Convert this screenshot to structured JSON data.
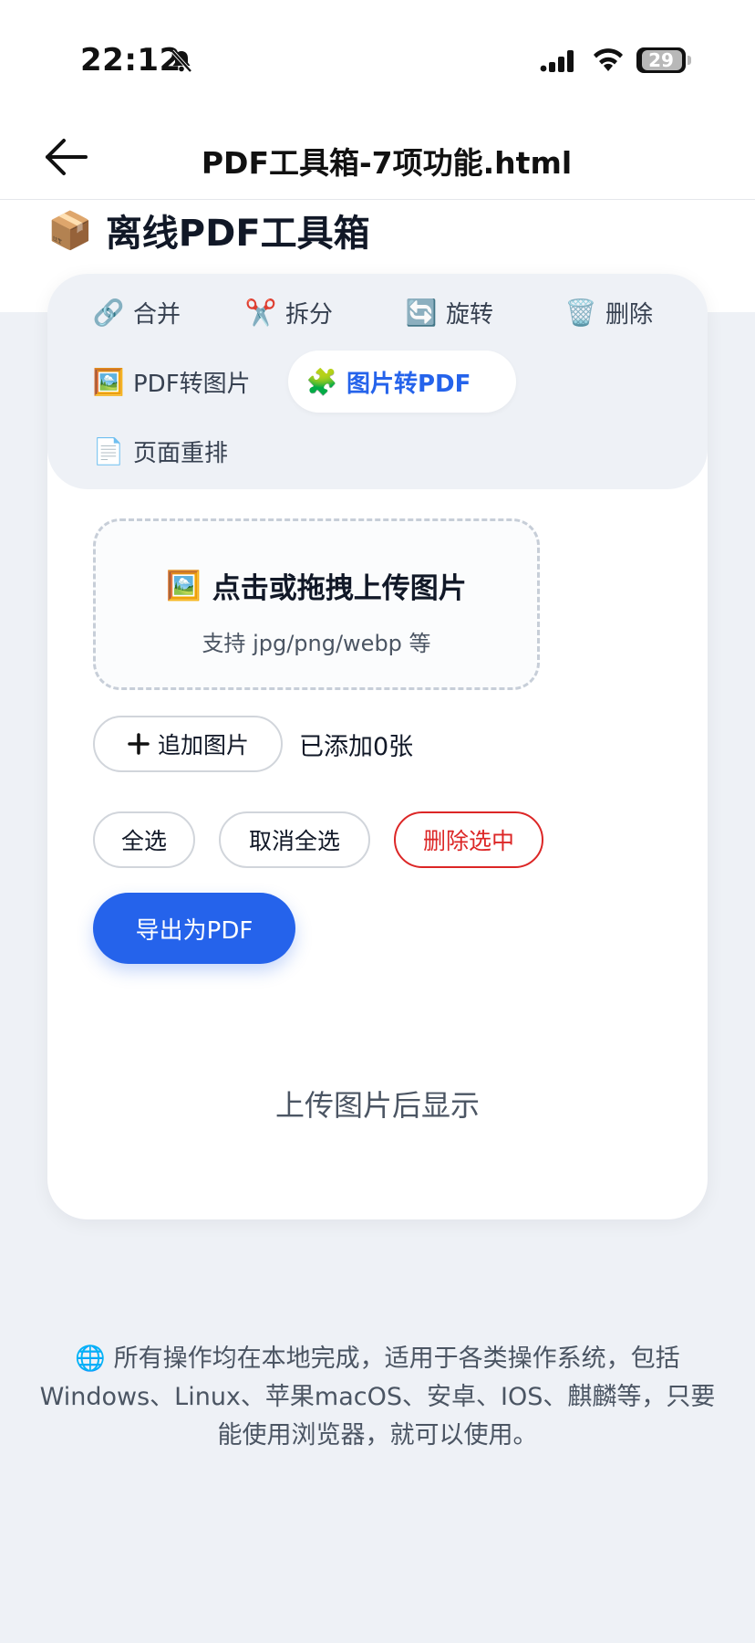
{
  "status": {
    "time": "22:12",
    "battery": "29"
  },
  "nav": {
    "title": "PDF工具箱-7项功能.html"
  },
  "app": {
    "title": "离线PDF工具箱",
    "title_emoji": "📦"
  },
  "tabs": [
    {
      "label": "合并",
      "icon": "link-icon",
      "emoji": "🔗",
      "active": false
    },
    {
      "label": "拆分",
      "icon": "scissors-icon",
      "emoji": "✂️",
      "active": false
    },
    {
      "label": "旋转",
      "icon": "rotate-icon",
      "emoji": "🔄",
      "active": false
    },
    {
      "label": "删除",
      "icon": "trash-icon",
      "emoji": "🗑️",
      "active": false
    },
    {
      "label": "PDF转图片",
      "icon": "picture-icon",
      "emoji": "🖼️",
      "active": false
    },
    {
      "label": "图片转PDF",
      "icon": "puzzle-icon",
      "emoji": "🧩",
      "active": true
    },
    {
      "label": "页面重排",
      "icon": "document-icon",
      "emoji": "📄",
      "active": false
    }
  ],
  "dropzone": {
    "emoji": "🖼️",
    "title": "点击或拖拽上传图片",
    "subtitle": "支持 jpg/png/webp 等"
  },
  "actions": {
    "add_label": "追加图片",
    "count_text": "已添加0张",
    "select_all": "全选",
    "deselect_all": "取消全选",
    "delete_selected": "删除选中",
    "export": "导出为PDF"
  },
  "placeholder": "上传图片后显示",
  "footer": {
    "emoji": "🌐",
    "line1": "所有操作均在本地完成，适用于各类操作系统，包括",
    "line2": "Windows、Linux、苹果macOS、安卓、IOS、麒麟等，只要",
    "line3": "能使用浏览器，就可以使用。"
  },
  "colors": {
    "accent": "#2563eb",
    "danger": "#dc2626",
    "background": "#eef1f6"
  }
}
